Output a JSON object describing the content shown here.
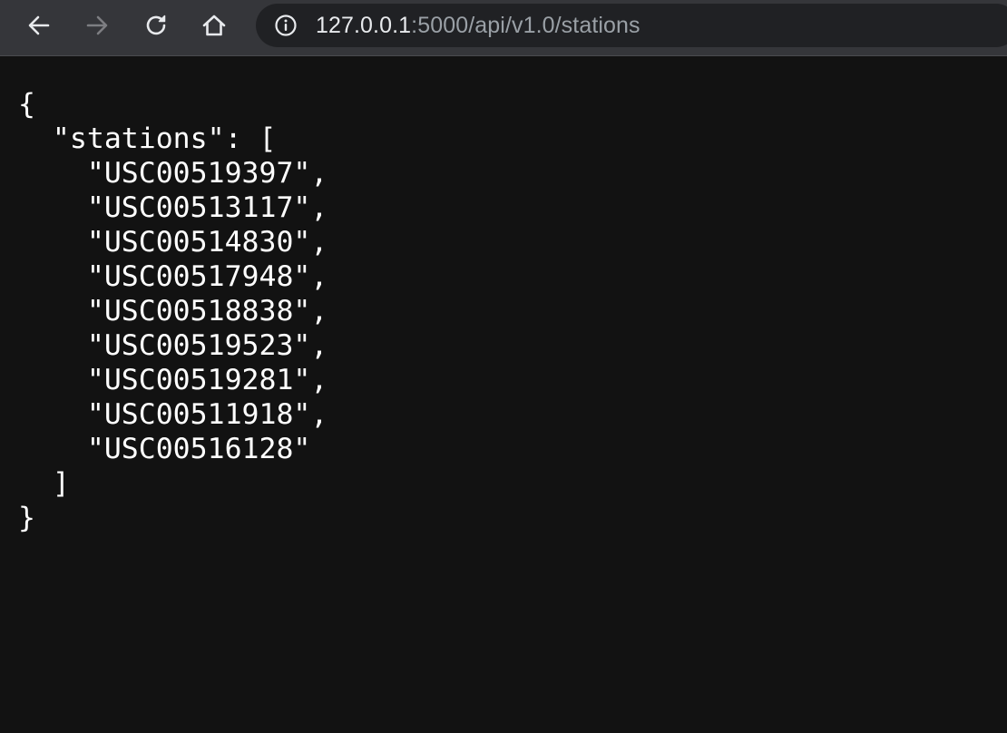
{
  "browser": {
    "url_host": "127.0.0.1",
    "url_rest": ":5000/api/v1.0/stations",
    "icons": {
      "back": "arrow-left-icon",
      "forward": "arrow-right-icon",
      "reload": "reload-icon",
      "home": "home-icon",
      "info": "info-icon"
    },
    "colors": {
      "toolbar": "#35363a",
      "omnibox": "#202124",
      "page_bg": "#121212",
      "text": "#ffffff"
    }
  },
  "json_view": {
    "lines": [
      "{",
      "  \"stations\": [",
      "    \"USC00519397\",",
      "    \"USC00513117\",",
      "    \"USC00514830\",",
      "    \"USC00517948\",",
      "    \"USC00518838\",",
      "    \"USC00519523\",",
      "    \"USC00519281\",",
      "    \"USC00511918\",",
      "    \"USC00516128\"",
      "  ]",
      "}"
    ]
  }
}
